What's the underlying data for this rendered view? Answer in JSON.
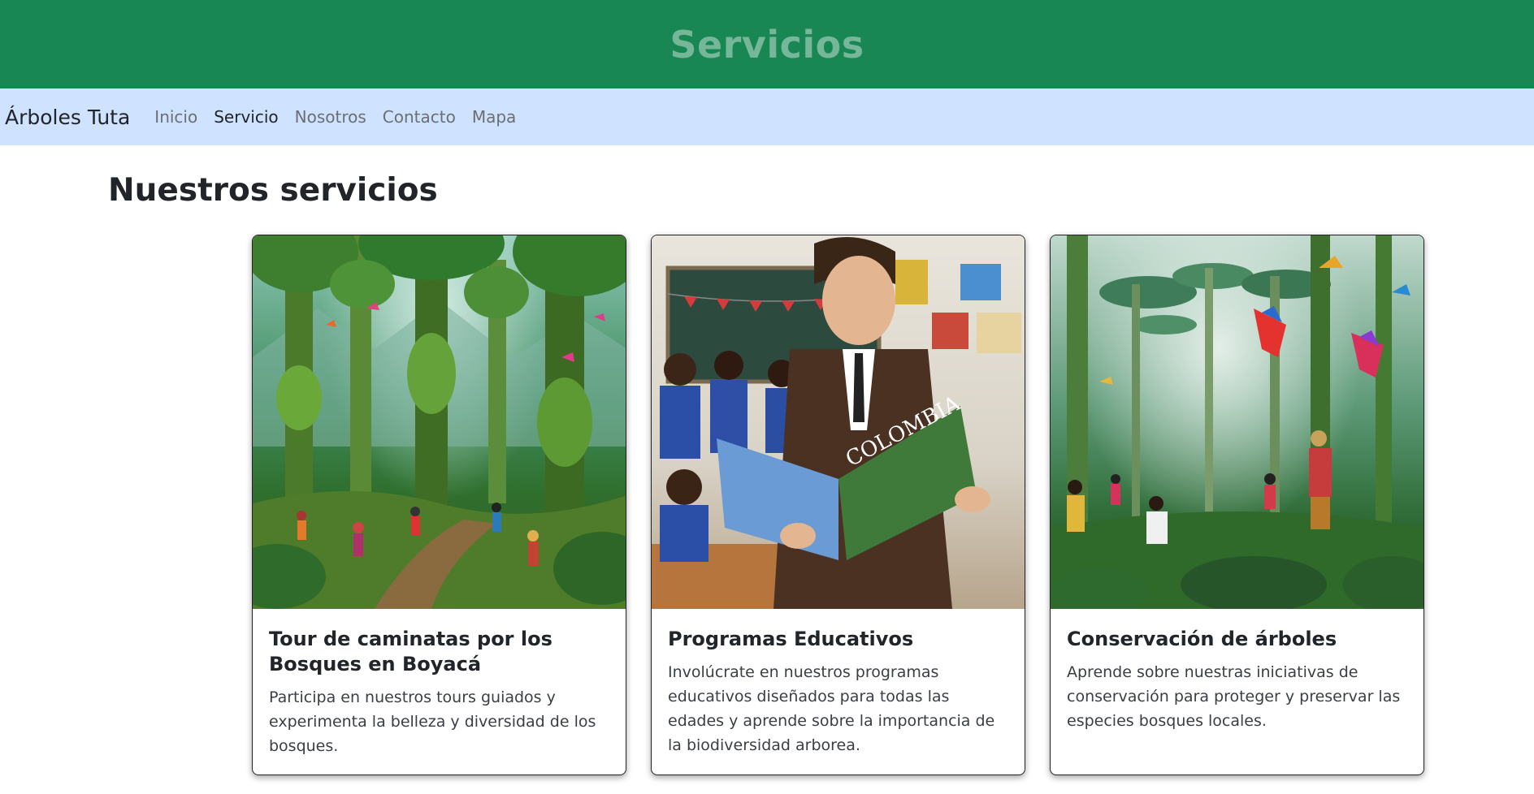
{
  "header": {
    "title": "Servicios"
  },
  "navbar": {
    "brand": "Árboles Tuta",
    "links": [
      {
        "label": "Inicio",
        "active": false
      },
      {
        "label": "Servicio",
        "active": true
      },
      {
        "label": "Nosotros",
        "active": false
      },
      {
        "label": "Contacto",
        "active": false
      },
      {
        "label": "Mapa",
        "active": false
      }
    ]
  },
  "main": {
    "title": "Nuestros servicios",
    "cards": [
      {
        "title": "Tour de caminatas por los Bosques en Boyacá",
        "text": "Participa en nuestros tours guiados y experimenta la belleza y diversidad de los bosques.",
        "image": "forest-hiking-illustration"
      },
      {
        "title": "Programas Educativos",
        "text": "Involúcrate en nuestros programas educativos diseñados para todas las edades y aprende sobre la importancia de la biodiversidad arborea.",
        "image": "classroom-teacher-illustration",
        "magazine_word": "COLOMBIA"
      },
      {
        "title": "Conservación de árboles",
        "text": "Aprende sobre nuestras iniciativas de conservación para proteger y preservar las especies bosques locales.",
        "image": "forest-conservation-illustration"
      }
    ]
  },
  "colors": {
    "header_bg": "#198754",
    "header_text": "#75b798",
    "navbar_bg": "#cfe2ff"
  }
}
